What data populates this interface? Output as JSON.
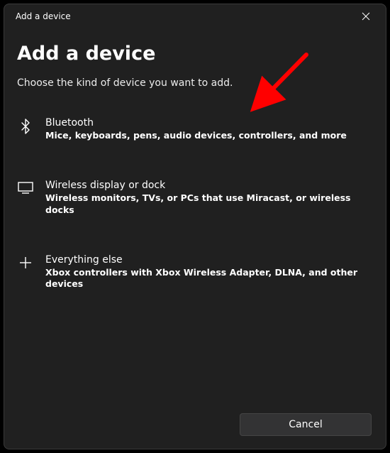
{
  "titlebar": {
    "title": "Add a device"
  },
  "heading": "Add a device",
  "subheading": "Choose the kind of device you want to add.",
  "options": [
    {
      "title": "Bluetooth",
      "desc": "Mice, keyboards, pens, audio devices, controllers, and more"
    },
    {
      "title": "Wireless display or dock",
      "desc": "Wireless monitors, TVs, or PCs that use Miracast, or wireless docks"
    },
    {
      "title": "Everything else",
      "desc": "Xbox controllers with Xbox Wireless Adapter, DLNA, and other devices"
    }
  ],
  "footer": {
    "cancel_label": "Cancel"
  },
  "annotation": {
    "arrow_color": "#ff0000"
  }
}
